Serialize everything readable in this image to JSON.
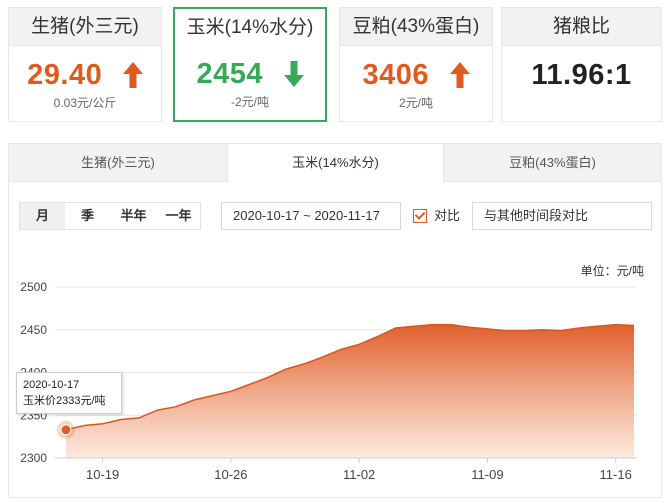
{
  "cards": [
    {
      "title": "生猪(外三元)",
      "value": "29.40",
      "change_num": "0.03",
      "change_unit": "元/公斤",
      "direction": "up"
    },
    {
      "title": "玉米(14%水分)",
      "value": "2454",
      "change_num": "-2",
      "change_unit": "元/吨",
      "direction": "down"
    },
    {
      "title": "豆粕(43%蛋白)",
      "value": "3406",
      "change_num": "2",
      "change_unit": "元/吨",
      "direction": "up"
    },
    {
      "title": "猪粮比",
      "value": "11.96:1"
    }
  ],
  "tabs": [
    "生猪(外三元)",
    "玉米(14%水分)",
    "豆粕(43%蛋白)"
  ],
  "active_tab": 1,
  "periods": [
    "月",
    "季",
    "半年",
    "一年"
  ],
  "active_period": 0,
  "date_range": "2020-10-17 ~ 2020-11-17",
  "compare": {
    "label": "对比",
    "checked": true
  },
  "compare_other_placeholder": "与其他时间段对比",
  "unit_label": "单位：元/吨",
  "tooltip": {
    "date": "2020-10-17",
    "text": "玉米价2333元/吨"
  },
  "colors": {
    "up": "#e05a1d",
    "down": "#3aa85a",
    "area_top": "#e0602a",
    "area_bottom": "#fde8dc"
  },
  "chart_data": {
    "type": "area",
    "title": "",
    "xlabel": "",
    "ylabel": "",
    "ylim": [
      2300,
      2500
    ],
    "yticks": [
      2300,
      2350,
      2400,
      2450,
      2500
    ],
    "x_ticks": [
      {
        "label": "10-19",
        "date": "2020-10-19"
      },
      {
        "label": "10-26",
        "date": "2020-10-26"
      },
      {
        "label": "11-02",
        "date": "2020-11-02"
      },
      {
        "label": "11-09",
        "date": "2020-11-09"
      },
      {
        "label": "11-16",
        "date": "2020-11-16"
      }
    ],
    "x": [
      "2020-10-17",
      "2020-10-18",
      "2020-10-19",
      "2020-10-20",
      "2020-10-21",
      "2020-10-22",
      "2020-10-23",
      "2020-10-24",
      "2020-10-25",
      "2020-10-26",
      "2020-10-27",
      "2020-10-28",
      "2020-10-29",
      "2020-10-30",
      "2020-10-31",
      "2020-11-01",
      "2020-11-02",
      "2020-11-03",
      "2020-11-04",
      "2020-11-05",
      "2020-11-06",
      "2020-11-07",
      "2020-11-08",
      "2020-11-09",
      "2020-11-10",
      "2020-11-11",
      "2020-11-12",
      "2020-11-13",
      "2020-11-14",
      "2020-11-15",
      "2020-11-16",
      "2020-11-17"
    ],
    "series": [
      {
        "values": [
          2333,
          2338,
          2340,
          2345,
          2347,
          2356,
          2360,
          2368,
          2373,
          2378,
          2386,
          2394,
          2404,
          2410,
          2418,
          2427,
          2433,
          2442,
          2452,
          2454,
          2456,
          2456,
          2453,
          2451,
          2449,
          2449,
          2450,
          2449,
          2452,
          2454,
          2456,
          2455
        ]
      }
    ]
  }
}
